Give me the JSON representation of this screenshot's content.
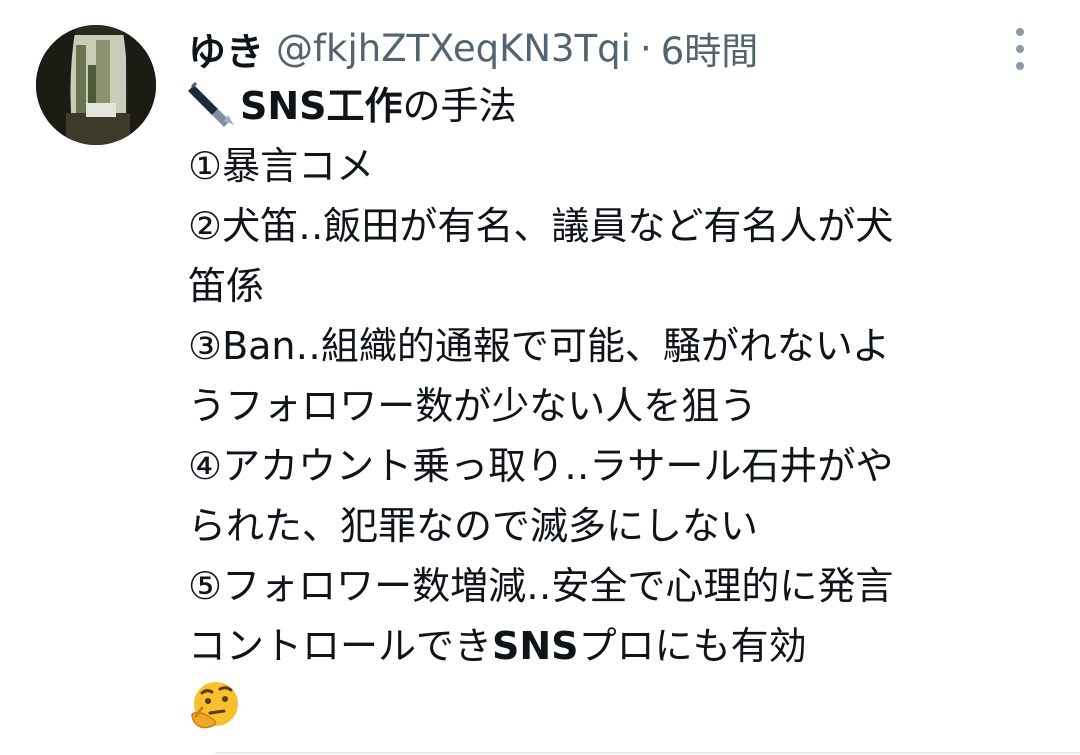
{
  "tweet": {
    "author": {
      "display_name": "ゆき",
      "handle": "@fkjhZTXeqKN3Tqi",
      "separator": "·",
      "time": "6時間"
    },
    "more_icon": "more-vertical-icon",
    "lines": {
      "title_bold": "SNS工作",
      "title_rest": "の手法",
      "l1": "①暴言コメ",
      "l2": "②犬笛‥飯田が有名、議員など有名人が犬",
      "l3": "笛係",
      "l4": "③Ban‥組織的通報で可能、騒がれないよ",
      "l5": "うフォロワー数が少ない人を狙う",
      "l6": "④アカウント乗っ取り‥ラサール石井がや",
      "l7": "られた、犯罪なので滅多にしない",
      "l8": "⑤フォロワー数増減‥安全で心理的に発言",
      "l9a": "コントロールでき",
      "l9b": "SNS",
      "l9c": "プロにも有効"
    },
    "emoji_start": "fountain-pen-emoji",
    "emoji_end": "thinking-face-emoji"
  }
}
